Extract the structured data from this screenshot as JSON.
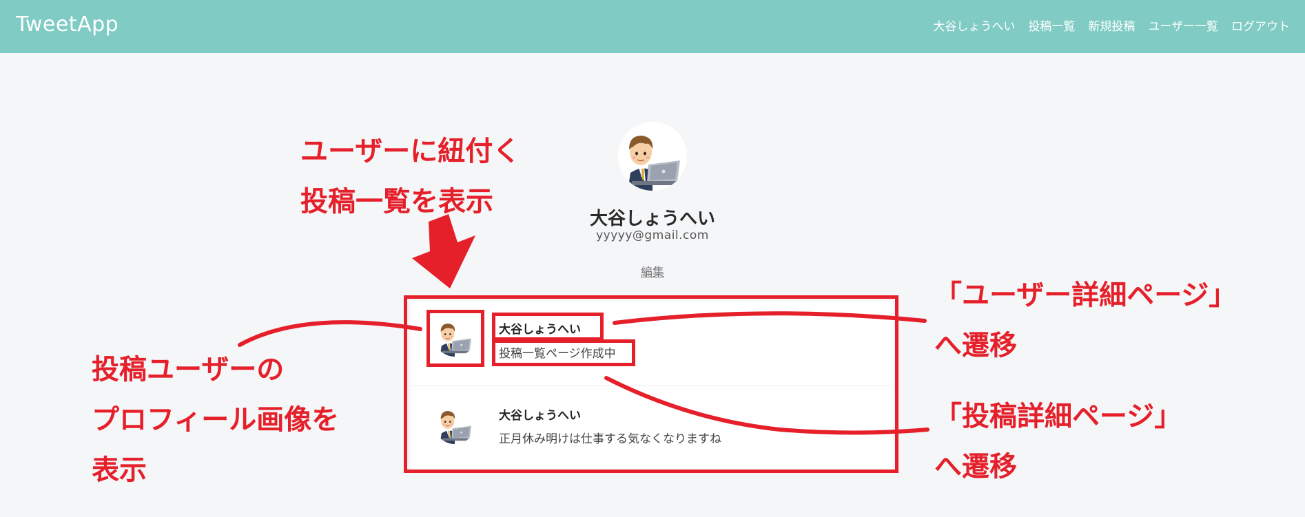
{
  "header": {
    "logo": "TweetApp",
    "nav": [
      "大谷しょうへい",
      "投稿一覧",
      "新規投稿",
      "ユーザー一覧",
      "ログアウト"
    ]
  },
  "profile": {
    "name": "大谷しょうへい",
    "email": "yyyyy@gmail.com",
    "edit_label": "編集"
  },
  "posts": [
    {
      "user": "大谷しょうへい",
      "text": "投稿一覧ページ作成中"
    },
    {
      "user": "大谷しょうへい",
      "text": "正月休み明けは仕事する気なくなりますね"
    }
  ],
  "annotations": {
    "posts_list": [
      "ユーザーに紐付く",
      "投稿一覧を表示"
    ],
    "profile_image": [
      "投稿ユーザーの",
      "プロフィール画像を",
      "表示"
    ],
    "user_detail": [
      "「ユーザー詳細ページ」",
      "へ遷移"
    ],
    "post_detail": [
      "「投稿詳細ページ」",
      "へ遷移"
    ]
  },
  "colors": {
    "header": "#80cbc4",
    "annotation": "#e5202a",
    "background": "#f5f6f8"
  },
  "icons": [
    "user-avatar-icon"
  ]
}
